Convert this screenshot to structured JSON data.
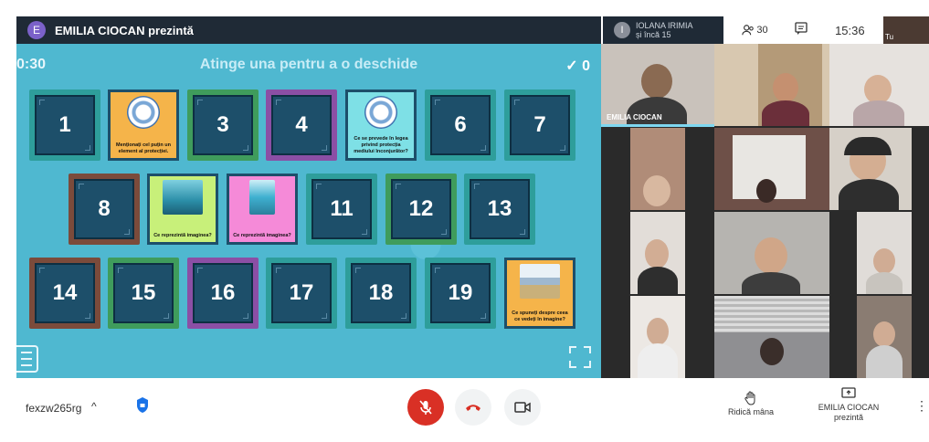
{
  "presenter": {
    "avatar_letter": "E",
    "title": "EMILIA CIOCAN prezintă"
  },
  "top_right": {
    "avatar_letter": "I",
    "names_line1": "IOLANA IRIMIA",
    "names_line2": "și încă 15",
    "people_count": "30",
    "time": "15:36",
    "self_label": "Tu"
  },
  "game": {
    "timer": "0:30",
    "title": "Atinge una pentru a o deschide",
    "score_icon": "check-icon",
    "score": "0",
    "cards": [
      {
        "label": "1"
      },
      {
        "label": "3"
      },
      {
        "label": "4"
      },
      {
        "label": "6"
      },
      {
        "label": "7"
      },
      {
        "label": "8"
      },
      {
        "label": "11"
      },
      {
        "label": "12"
      },
      {
        "label": "13"
      },
      {
        "label": "14"
      },
      {
        "label": "15"
      },
      {
        "label": "16"
      },
      {
        "label": "17"
      },
      {
        "label": "18"
      },
      {
        "label": "19"
      }
    ],
    "question_cards": [
      {
        "text": "Menționați cel puțin un element al protecției."
      },
      {
        "text": "Ce se prevede în legea privind protecția mediului înconjurător?"
      },
      {
        "text": "Ce reprezintă imaginea?"
      },
      {
        "text": "Ce reprezintă imaginea?"
      },
      {
        "text": "Ce spuneți despre ceea ce vedeți în imagine?"
      }
    ]
  },
  "video": {
    "main_tile_label": "EMILIA CIOCAN"
  },
  "bottom": {
    "meeting_code": "fexzw265rg",
    "raise_hand_label": "Ridică mâna",
    "presenting_line1": "EMILIA CIOCAN",
    "presenting_line2": "prezintă"
  },
  "colors": {
    "game_bg": "#4fb8d0",
    "mic_off": "#d93025",
    "end_call": "#d93025"
  }
}
